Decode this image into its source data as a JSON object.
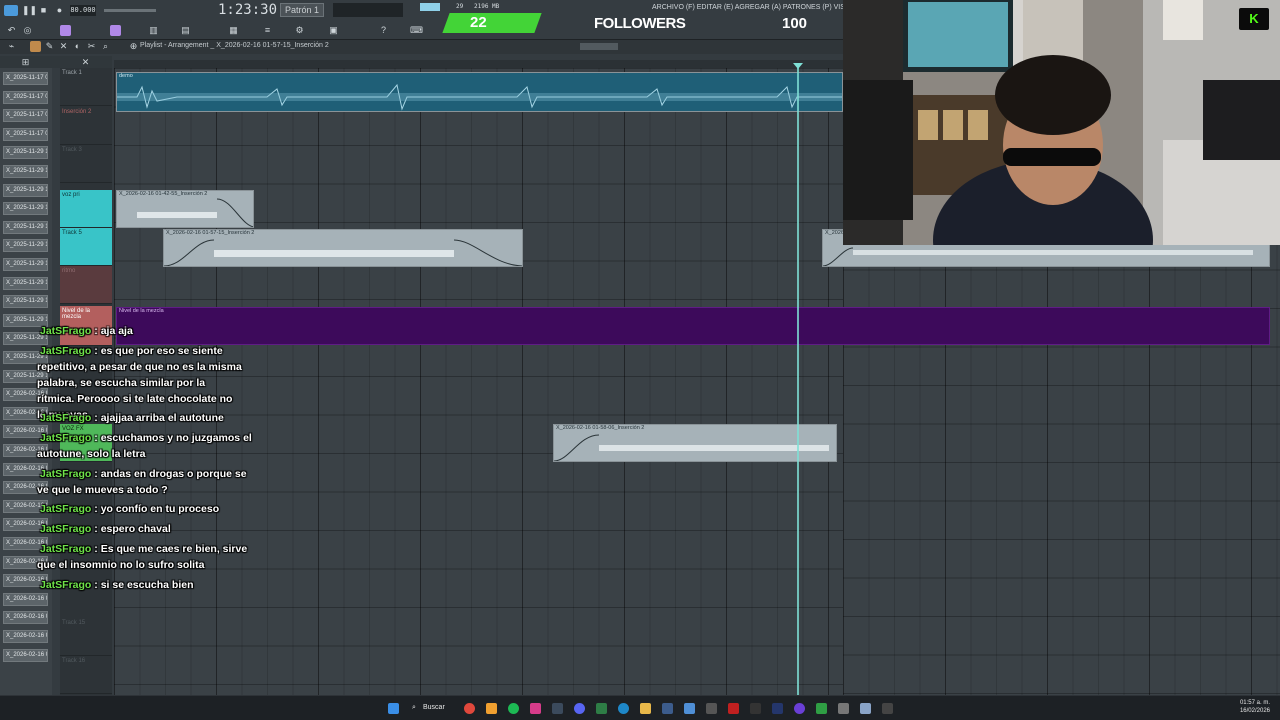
{
  "toolbar": {
    "transport_time": "1:23:30",
    "bpm_value": "80.000",
    "pattern_label": "Patrón 1",
    "menu_text": "ARCHIVO (F) EDITAR (E) AGREGAR (A) PATRONES (P) VISTA (V) OPCIONES",
    "cpu_value": "29",
    "mem_value": "2196 MB",
    "breadcrumb": "Playlist - Arrangement _ X_2026-02-16 01-57-15_Inserción 2"
  },
  "overlay": {
    "followers_count": "22",
    "followers_label": "FOLLOWERS",
    "followers_goal": "100",
    "kick_logo": "K"
  },
  "playlist_items": [
    "X_2025-11-17 0..",
    "X_2025-11-17 0..",
    "X_2025-11-17 0..",
    "X_2025-11-17 0..",
    "X_2025-11-29 1..",
    "X_2025-11-29 1..",
    "X_2025-11-29 1..",
    "X_2025-11-29 1..",
    "X_2025-11-29 1..",
    "X_2025-11-29 1..",
    "X_2025-11-29 1..",
    "X_2025-11-29 1..",
    "X_2025-11-29 1..",
    "X_2025-11-29 1..",
    "X_2025-11-29 1..",
    "X_2025-11-29 1..",
    "X_2025-11-29 1..",
    "X_2026-02-16 0..",
    "X_2026-02-16 0..",
    "X_2026-02-16 0..",
    "X_2026-02-16 0..",
    "X_2026-02-16 0..",
    "X_2026-02-16 0..",
    "X_2026-02-16 0..",
    "X_2026-02-16 0..",
    "X_2026-02-16 0..",
    "X_2026-02-16 0..",
    "X_2026-02-16 0..",
    "X_2026-02-16 0..",
    "X_2026-02-16 0..",
    "X_2026-02-16 0..",
    "X_2026-02-16 0.."
  ],
  "tracks": {
    "t1": "Track 1",
    "t2": "Inserción 2",
    "t3": "Track 3",
    "t4": "voz pri",
    "t5": "Track 5",
    "t6": "ritmo",
    "t7": "Nivel de la mezcla",
    "t9": "VOZ FX",
    "t15": "Track 15",
    "t16": "Track 16"
  },
  "clips": {
    "demo": "demo",
    "c1": "X_2026-02-16 01-42-55_Inserción 2",
    "c2": "X_2026-02-16 01-57-15_Inserción 2",
    "c3": "X_2026-02-16 01-58-06_Inserción 2",
    "c4": "X_2026-",
    "automation": "Nivel de la mezcla"
  },
  "chat": [
    {
      "user": "JatSFrago",
      "text": " : aja aja"
    },
    {
      "user": "JatSFrago",
      "text": " : es que por eso se siente",
      "cont": "repetitivo, a pesar de que no es la misma palabra, se escucha similar por la rítmica. Peroooo si te late chocolate no le muevas"
    },
    {
      "user": "JatSFrago",
      "text": " : ajajjaa arriba el autotune"
    },
    {
      "user": "JatSFrago",
      "text": " : escuchamos y no juzgamos el",
      "cont": "autotune, solo la letra"
    },
    {
      "user": "JatSFrago",
      "text": " : andas en drogas o porque se",
      "cont": "ve que le mueves a todo ?"
    },
    {
      "user": "JatSFrago",
      "text": " : yo confío en tu proceso"
    },
    {
      "user": "JatSFrago",
      "text": " : espero chaval"
    },
    {
      "user": "JatSFrago",
      "text": " : Es que me caes re bien, sirve",
      "cont": "que el insomnio no lo sufro solita"
    },
    {
      "user": "JatSFrago",
      "text": " : si se escucha bien"
    }
  ],
  "taskbar": {
    "search_label": "Buscar",
    "time": "01:57 a. m.",
    "date": "16/02/2026"
  }
}
